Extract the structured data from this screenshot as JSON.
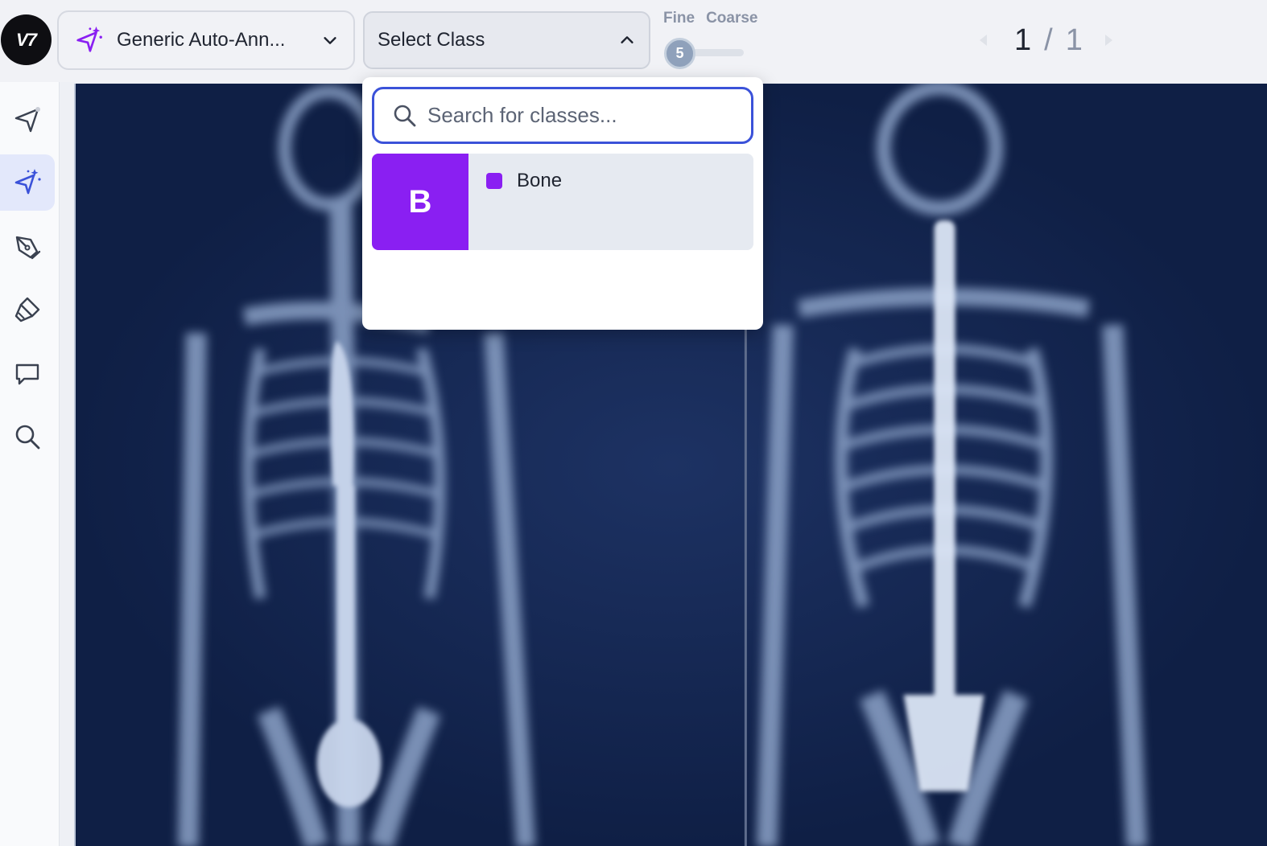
{
  "app": {
    "logo_text": "V7"
  },
  "toolbar": {
    "model_label": "Generic Auto-Ann...",
    "class_select_label": "Select Class",
    "slider": {
      "fine_label": "Fine",
      "coarse_label": "Coarse",
      "value": "5"
    },
    "pager": {
      "current": "1",
      "separator": "/",
      "total": "1"
    }
  },
  "tools": [
    {
      "name": "select-tool",
      "icon": "cursor-arrow-icon",
      "active": false
    },
    {
      "name": "auto-annotate-tool",
      "icon": "sparkle-cursor-icon",
      "active": true
    },
    {
      "name": "polygon-tool",
      "icon": "pen-icon",
      "active": false
    },
    {
      "name": "brush-tool",
      "icon": "brush-icon",
      "active": false
    },
    {
      "name": "comment-tool",
      "icon": "comment-icon",
      "active": false
    },
    {
      "name": "zoom-tool",
      "icon": "search-icon",
      "active": false
    }
  ],
  "dropdown": {
    "search_placeholder": "Search for classes...",
    "classes": [
      {
        "initial": "B",
        "name": "Bone",
        "color": "#8a1ff2"
      }
    ]
  },
  "colors": {
    "accent": "#3b52d9",
    "class_bone": "#8a1ff2",
    "image_background": "#0f1f45"
  }
}
